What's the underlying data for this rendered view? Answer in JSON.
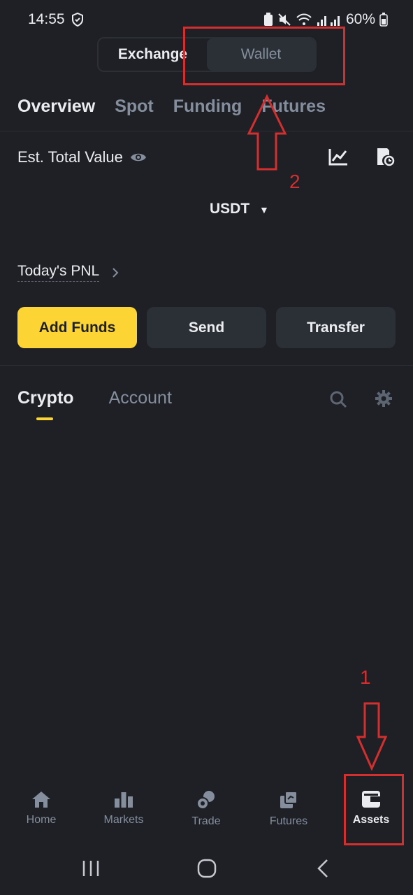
{
  "status_bar": {
    "time": "14:55",
    "battery": "60%"
  },
  "toggle": {
    "exchange": "Exchange",
    "wallet": "Wallet"
  },
  "top_tabs": [
    {
      "label": "Overview"
    },
    {
      "label": "Spot"
    },
    {
      "label": "Funding"
    },
    {
      "label": "Futures"
    }
  ],
  "overview": {
    "est_total_label": "Est. Total Value",
    "currency": "USDT",
    "pnl_label": "Today's PNL"
  },
  "actions": {
    "add_funds": "Add Funds",
    "send": "Send",
    "transfer": "Transfer"
  },
  "sub_tabs": {
    "crypto": "Crypto",
    "account": "Account"
  },
  "bottom_nav": [
    {
      "label": "Home",
      "icon": "home-icon"
    },
    {
      "label": "Markets",
      "icon": "bars-icon"
    },
    {
      "label": "Trade",
      "icon": "trade-icon"
    },
    {
      "label": "Futures",
      "icon": "futures-icon"
    },
    {
      "label": "Assets",
      "icon": "wallet-icon"
    }
  ],
  "annotations": {
    "step1": "1",
    "step2": "2"
  },
  "colors": {
    "accent": "#fcd535",
    "background": "#1e2026",
    "annotation": "#d32f2f"
  }
}
